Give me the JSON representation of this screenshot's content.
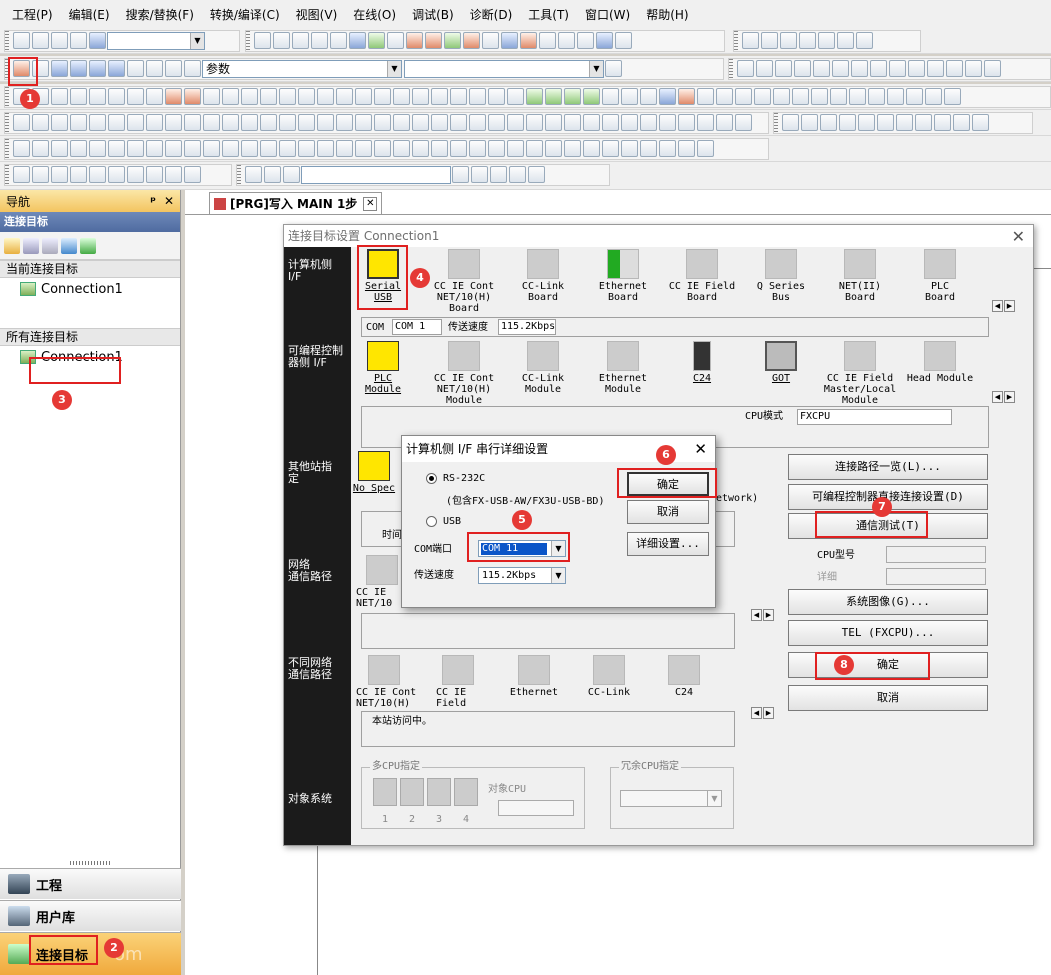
{
  "menu": [
    "工程(P)",
    "编辑(E)",
    "搜索/替换(F)",
    "转换/编译(C)",
    "视图(V)",
    "在线(O)",
    "调试(B)",
    "诊断(D)",
    "工具(T)",
    "窗口(W)",
    "帮助(H)"
  ],
  "toolbar": {
    "search_combo": "参数"
  },
  "nav": {
    "title": "导航",
    "pin": "ᵖ",
    "close": "✕",
    "section": "连接目标",
    "current_group": "当前连接目标",
    "current_item": "Connection1",
    "all_group": "所有连接目标",
    "all_item": "Connection1",
    "bottom": [
      "工程",
      "用户库",
      "连接目标"
    ]
  },
  "editor": {
    "tab": "[PRG]写入 MAIN 1步"
  },
  "dialog": {
    "title": "连接目标设置 Connection1",
    "side": {
      "pc_if": "计算机侧\nI/F",
      "plc_if": "可编程控制\n器侧 I/F",
      "other": "其他站指\n定",
      "net": "网络\n通信路径",
      "diffnet": "不同网络\n通信路径",
      "target": "对象系统"
    },
    "pc_devices": [
      "Serial\nUSB",
      "CC IE Cont\nNET/10(H)\nBoard",
      "CC-Link\nBoard",
      "Ethernet\nBoard",
      "CC IE Field\nBoard",
      "Q Series\nBus",
      "NET(II)\nBoard",
      "PLC\nBoard"
    ],
    "com_label": "COM",
    "com_value": "COM 1",
    "baud_label": "传送速度",
    "baud_value": "115.2Kbps",
    "plc_devices": [
      "PLC\nModule",
      "CC IE Cont\nNET/10(H)\nModule",
      "CC-Link\nModule",
      "Ethernet\nModule",
      "C24",
      "GOT",
      "CC IE Field\nMaster/Local\nModule",
      "Head Module"
    ],
    "cpu_mode_label": "CPU模式",
    "cpu_mode_value": "FXCPU",
    "other_station": "No Spec",
    "other_time": "时间",
    "other_network": "etwork)",
    "net_device": "CC IE\nNET/10",
    "diff_devices": [
      "CC IE Cont\nNET/10(H)",
      "CC IE\nField",
      "Ethernet",
      "CC-Link",
      "C24"
    ],
    "status_text": "本站访问中。",
    "multi_cpu": "多CPU指定",
    "target_cpu": "对象CPU",
    "cpu_nums": [
      "1",
      "2",
      "3",
      "4"
    ],
    "redundant_cpu": "冗余CPU指定",
    "buttons": {
      "route_list": "连接路径一览(L)...",
      "direct": "可编程控制器直接连接设置(D)",
      "comm_test": "通信测试(T)",
      "cpu_type": "CPU型号",
      "detail": "详细",
      "system_image": "系统图像(G)...",
      "tel": "TEL (FXCPU)...",
      "ok": "确定",
      "cancel": "取消"
    }
  },
  "subdialog": {
    "title": "计算机侧 I/F 串行详细设置",
    "close": "✕",
    "rs232": "RS-232C",
    "rs232_note": "(包含FX-USB-AW/FX3U-USB-BD)",
    "usb": "USB",
    "com_port_label": "COM端口",
    "com_port_value": "COM 11",
    "baud_label": "传送速度",
    "baud_value": "115.2Kbps",
    "ok": "确定",
    "cancel": "取消",
    "detail": "详细设置..."
  },
  "markers": [
    "1",
    "2",
    "3",
    "4",
    "5",
    "6",
    "7",
    "8"
  ],
  "watermark": "om"
}
